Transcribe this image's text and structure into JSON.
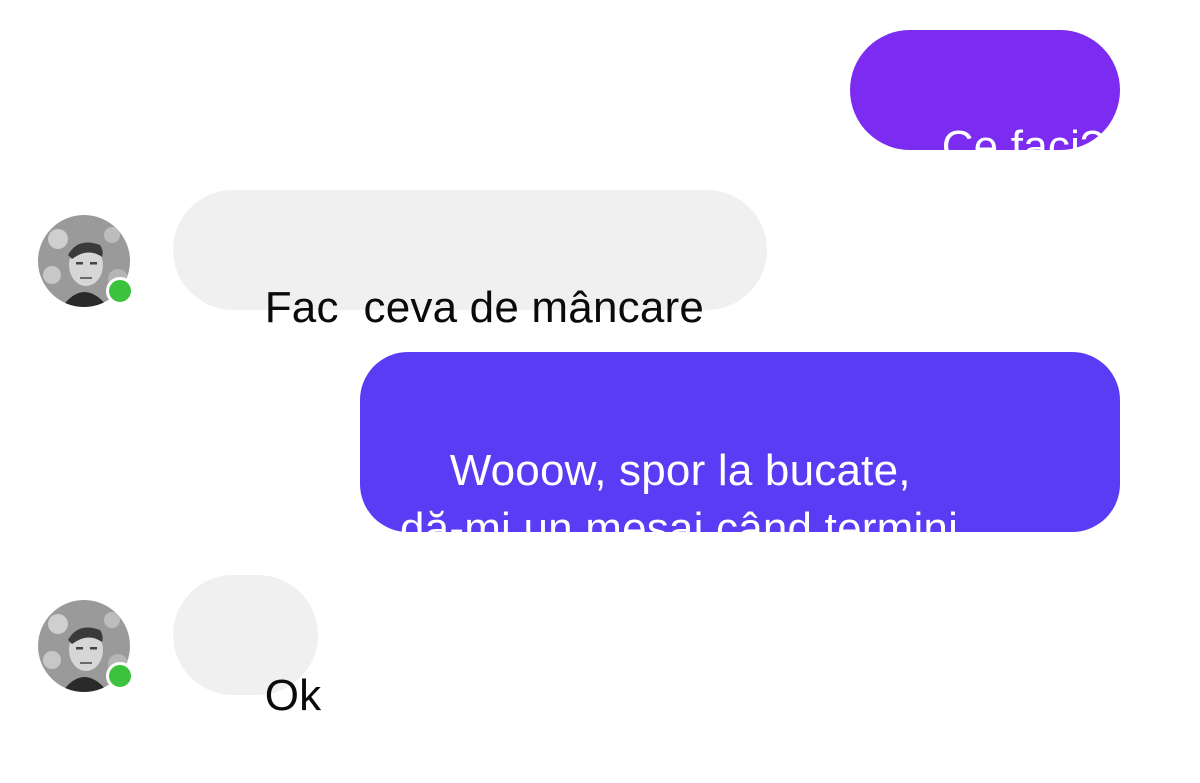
{
  "messages": [
    {
      "direction": "outgoing",
      "text": "Ce faci?"
    },
    {
      "direction": "incoming",
      "text": "Fac  ceva de mâncare"
    },
    {
      "direction": "outgoing",
      "text": "Wooow, spor la bucate,\ndă-mi un mesaj când termini"
    },
    {
      "direction": "incoming",
      "text": "Ok"
    }
  ],
  "contact": {
    "avatar_icon": "contact-avatar-photo",
    "online": true
  },
  "colors": {
    "outgoing_bubble_first": "#7b2cf0",
    "outgoing_bubble_second": "#5a3cf5",
    "incoming_bubble": "#f0f0f0",
    "online_dot": "#3cc23c"
  }
}
